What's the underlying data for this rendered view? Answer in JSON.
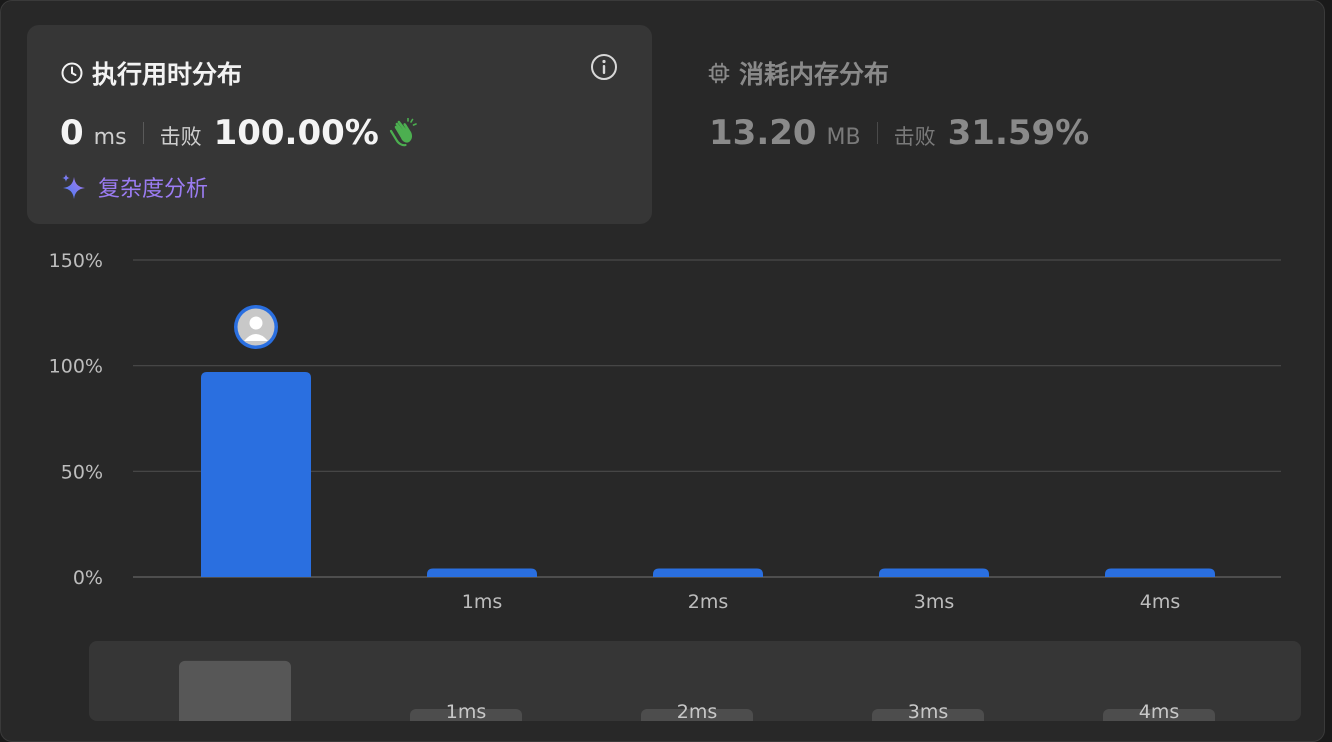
{
  "runtime": {
    "title": "执行用时分布",
    "value": "0",
    "unit": "ms",
    "beat_label": "击败",
    "beat_value": "100.00%",
    "complexity_label": "复杂度分析"
  },
  "memory": {
    "title": "消耗内存分布",
    "value": "13.20",
    "unit": "MB",
    "beat_label": "击败",
    "beat_value": "31.59%"
  },
  "colors": {
    "accent": "#2a6fe0",
    "complexity": "#9b7cf2",
    "clap": "#4caf50"
  },
  "icons": [
    "clock-icon",
    "info-icon",
    "clapping-hands-icon",
    "sparkle-icon",
    "chip-icon",
    "avatar-icon"
  ],
  "chart_data": {
    "type": "bar",
    "categories": [
      "",
      "1ms",
      "2ms",
      "3ms",
      "4ms"
    ],
    "values": [
      97,
      4,
      4,
      4,
      4
    ],
    "y_ticks": [
      "0%",
      "50%",
      "100%",
      "150%"
    ],
    "ylim": [
      0,
      150
    ],
    "grid": true,
    "highlighted_category": 0
  },
  "navigator": {
    "labels": [
      "1ms",
      "2ms",
      "3ms",
      "4ms"
    ]
  }
}
